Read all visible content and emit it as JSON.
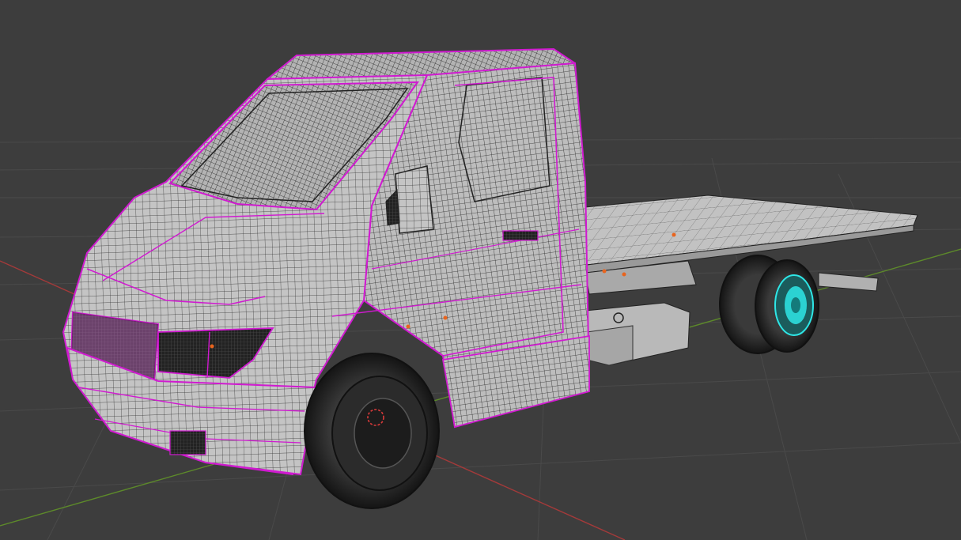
{
  "viewport": {
    "background": "#3d3d3d",
    "grid_color": "#4a4a4a",
    "x_axis_color": "#a33a3a",
    "y_axis_color": "#5d8a2a",
    "seam_color": "#d01ad0",
    "mesh_fill": "#b8b8b8",
    "wire_color": "#262626",
    "selected_color": "#2ee6e6",
    "vertex_marker_color": "#e8641e",
    "tire_color": "#1e1e1e"
  },
  "model": {
    "object": "flatbed-truck",
    "mode": "edit-wireframe",
    "selected_part": "rear-wheel-hub"
  }
}
